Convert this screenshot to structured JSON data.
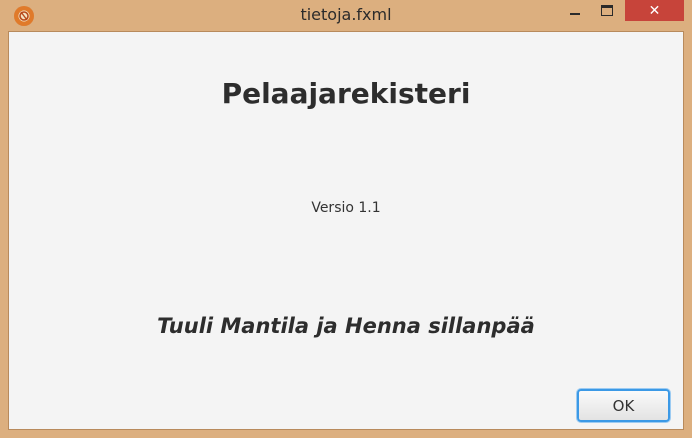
{
  "window": {
    "title": "tietoja.fxml",
    "close_glyph": "✕",
    "icon": "app-logo-icon"
  },
  "content": {
    "heading": "Pelaajarekisteri",
    "version": "Versio 1.1",
    "authors": "Tuuli Mantila ja Henna sillanpää"
  },
  "buttons": {
    "ok_label": "OK"
  },
  "colors": {
    "titlebar": "#dcaf7f",
    "client_bg": "#f4f4f4",
    "close_button": "#c7443a",
    "focus_border": "#3b99e6"
  }
}
